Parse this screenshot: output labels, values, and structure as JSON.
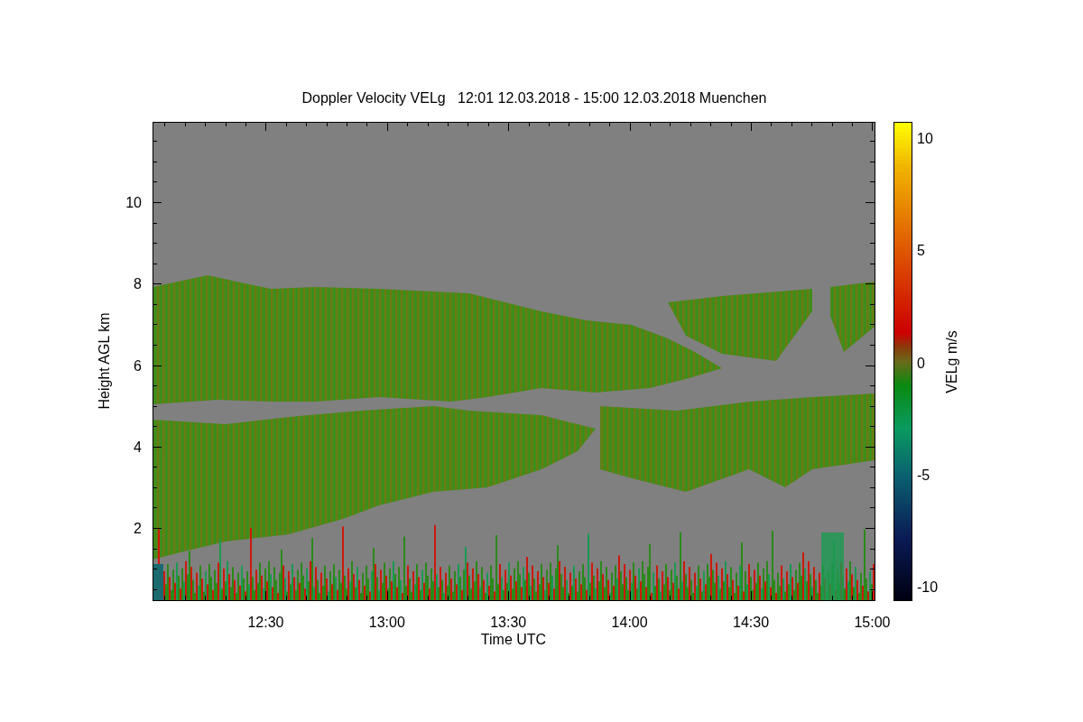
{
  "plot": {
    "title": "Doppler Velocity VELg   12:01 12.03.2018 - 15:00 12.03.2018 Muenchen",
    "xlabel": "Time UTC",
    "ylabel": "Height AGL km",
    "xticks": [
      "12:30",
      "13:00",
      "13:30",
      "14:00",
      "14:30",
      "15:00"
    ],
    "yticks": [
      "10",
      "8",
      "6",
      "4",
      "2"
    ]
  },
  "colorbar": {
    "label": "VELg m/s",
    "ticks": [
      "10",
      "5",
      "0",
      "-5",
      "-10"
    ]
  }
}
